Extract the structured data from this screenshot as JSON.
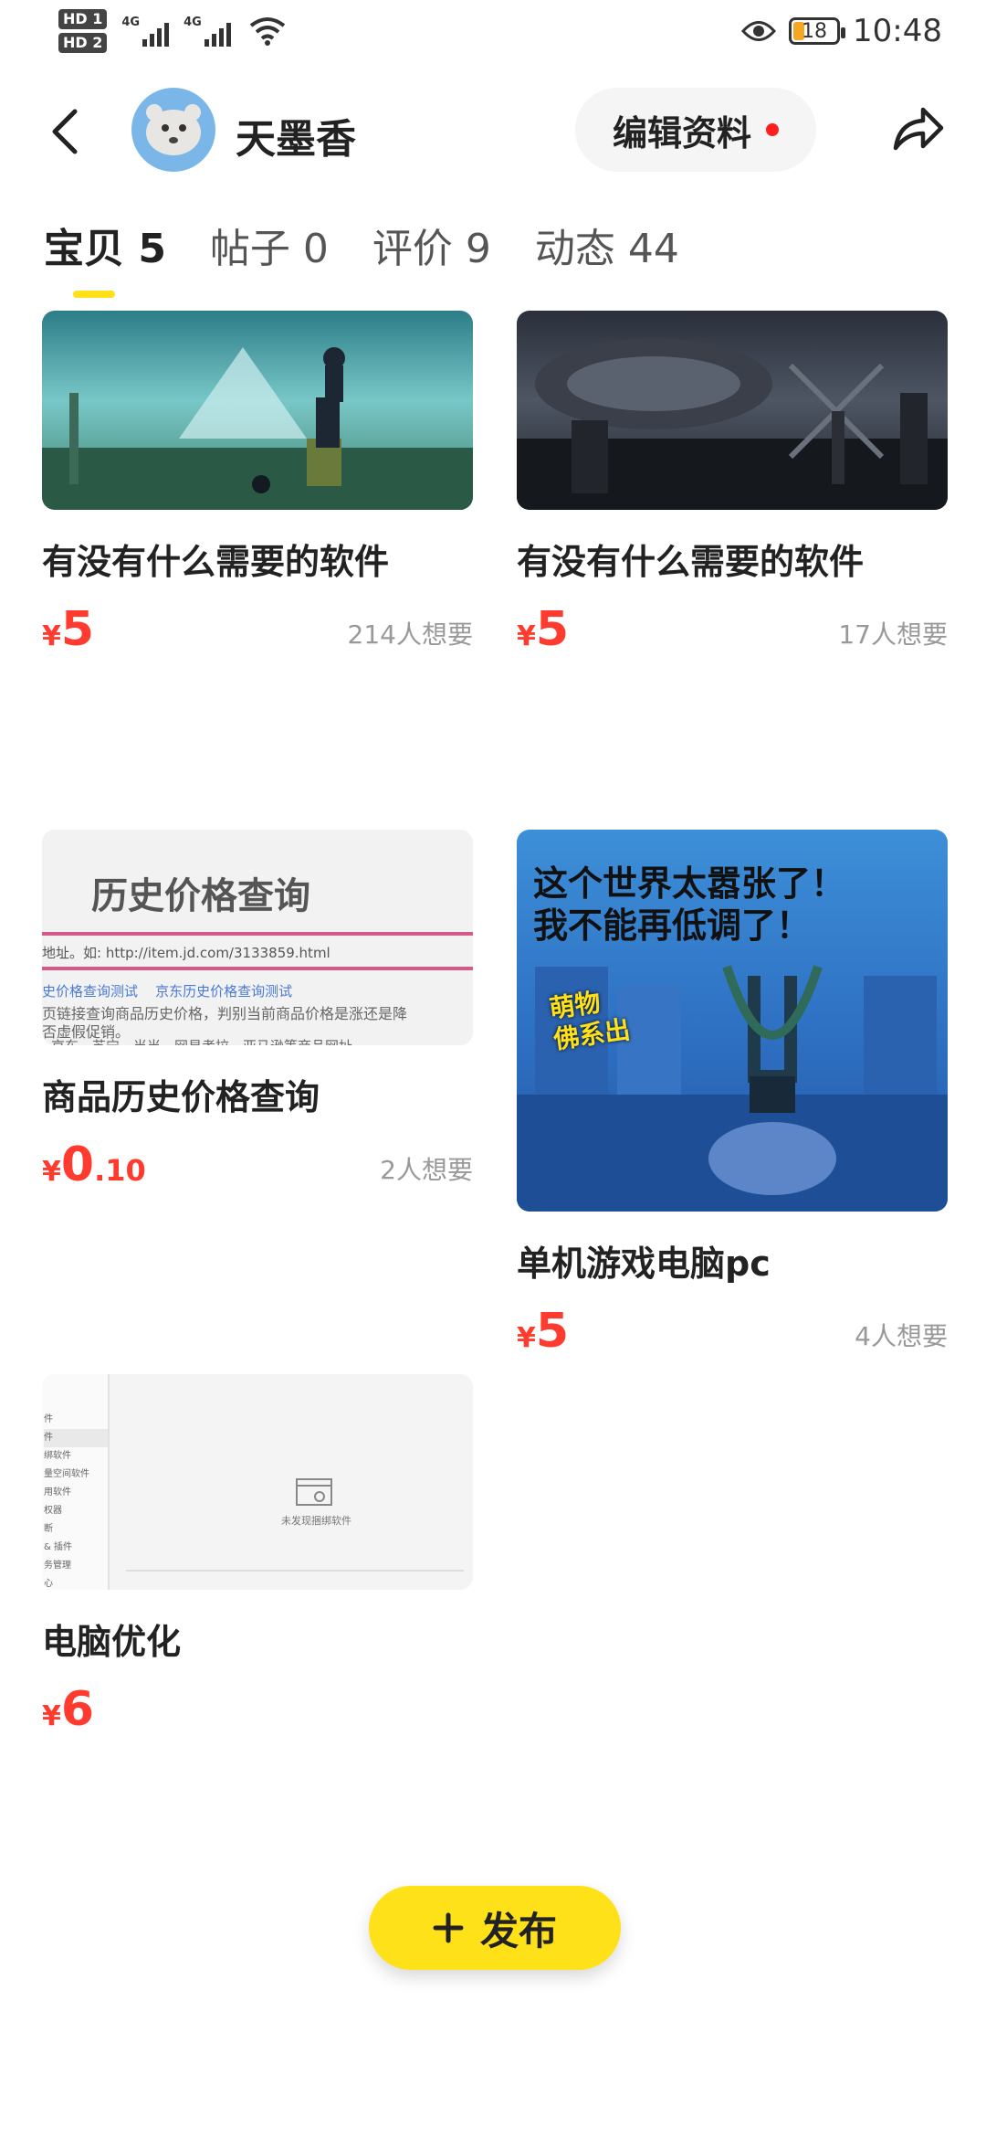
{
  "status_bar": {
    "sim1": "HD 1",
    "sim2": "HD 2",
    "network1": "4G",
    "network2": "4G",
    "battery": "18",
    "time": "10:48"
  },
  "header": {
    "username": "天墨香",
    "edit_label": "编辑资料"
  },
  "tabs": [
    {
      "label": "宝贝 5",
      "active": true
    },
    {
      "label": "帖子 0"
    },
    {
      "label": "评价 9"
    },
    {
      "label": "动态 44"
    }
  ],
  "items": [
    {
      "title": "有没有什么需要的软件",
      "currency": "¥",
      "price_int": "5",
      "price_dec": "",
      "wants": "214人想要"
    },
    {
      "title": "有没有什么需要的软件",
      "currency": "¥",
      "price_int": "5",
      "price_dec": "",
      "wants": "17人想要"
    },
    {
      "title": "商品历史价格查询",
      "currency": "¥",
      "price_int": "0",
      "price_dec": ".10",
      "wants": "2人想要",
      "thumb": {
        "heading": "历史价格查询",
        "url_line": "地址。如: http://item.jd.com/3133859.html",
        "links": "史价格查询测试    京东历史价格查询测试",
        "desc1": "页链接查询商品历史价格，判别当前商品价格是涨还是降",
        "desc2": "否虚假促销。",
        "desc3": "京东、苏宁、当当、网易考拉、亚马逊等商品网址。"
      }
    },
    {
      "title": "单机游戏电脑pc",
      "currency": "¥",
      "price_int": "5",
      "price_dec": "",
      "wants": "4人想要",
      "thumb": {
        "line1": "这个世界太嚣张了！",
        "line2": "我不能再低调了！",
        "sticker1": "萌物",
        "sticker2": "佛系出"
      }
    },
    {
      "title": "电脑优化",
      "currency": "¥",
      "price_int": "6",
      "price_dec": "",
      "wants": "",
      "thumb": {
        "empty_text": "未发现捆绑软件",
        "menu": [
          "件",
          "件",
          "绑软件",
          "量空间软件",
          "用软件",
          "权器",
          "断",
          "& 插件",
          "务管理",
          "心"
        ]
      }
    }
  ],
  "fab": {
    "label": "发布"
  },
  "colors": {
    "accent": "#ffe11a",
    "price": "#ff3b30"
  }
}
